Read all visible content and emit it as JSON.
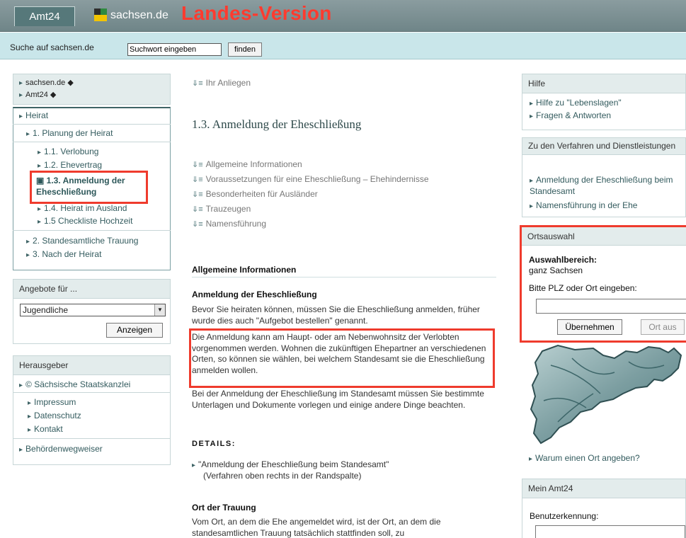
{
  "header": {
    "tab_label": "Amt24",
    "logo_text": "sachsen.de",
    "version_label": "Landes-Version"
  },
  "search": {
    "label": "Suche auf sachsen.de",
    "placeholder": "Suchwort eingeben",
    "button": "finden"
  },
  "left": {
    "breadcrumbs": [
      "sachsen.de",
      "Amt24"
    ],
    "nav": {
      "heirat": "Heirat",
      "planung": "1. Planung der Heirat",
      "verlobung": "1.1. Verlobung",
      "ehevertrag": "1.2. Ehevertrag",
      "active": "1.3. Anmeldung der Eheschließung",
      "ausland": "1.4. Heirat im Ausland",
      "checkliste": "1.5 Checkliste Hochzeit",
      "trauung": "2. Standesamtliche Trauung",
      "nach": "3. Nach der Heirat"
    },
    "angebote": {
      "title": "Angebote für ...",
      "selected": "Jugendliche",
      "button": "Anzeigen"
    },
    "herausgeber": {
      "title": "Herausgeber",
      "staatskanzlei": "© Sächsische Staatskanzlei",
      "impressum": "Impressum",
      "datenschutz": "Datenschutz",
      "kontakt": "Kontakt",
      "wegweiser": "Behördenwegweiser"
    }
  },
  "main": {
    "anliegen": "Ihr Anliegen",
    "title": "1.3. Anmeldung der Eheschließung",
    "toc": [
      "Allgemeine Informationen",
      "Voraussetzungen für eine Eheschließung – Ehehindernisse",
      "Besonderheiten für Ausländer",
      "Trauzeugen",
      "Namensführung"
    ],
    "section_allg": "Allgemeine Informationen",
    "sub_anmeldung": "Anmeldung der Eheschließung",
    "p1": "Bevor Sie heiraten können, müssen Sie die Eheschließung anmelden, früher wurde dies auch \"Aufgebot bestellen\" genannt.",
    "p2": "Die Anmeldung kann am Haupt- oder am Nebenwohnsitz der Verlobten vorgenommen werden. Wohnen die zukünftigen Ehepartner an verschiedenen Orten, so können sie wählen, bei welchem Standesamt sie die Eheschließung anmelden wollen.",
    "p3": "Bei der Anmeldung der Eheschließung im Standesamt müssen Sie bestimmte Unterlagen und Dokumente vorlegen und einige andere Dinge beachten.",
    "details": "DETAILS:",
    "detail_link": "\"Anmeldung der Eheschließung beim Standesamt\"",
    "detail_note": "(Verfahren oben rechts in der Randspalte)",
    "sub_ort": "Ort der Trauung",
    "p4": "Vom Ort, an dem die Ehe angemeldet wird, ist der Ort, an dem die standesamtlichen Trauung tatsächlich stattfinden soll, zu"
  },
  "right": {
    "hilfe": {
      "title": "Hilfe",
      "links": [
        "Hilfe zu \"Lebenslagen\"",
        "Fragen & Antworten"
      ]
    },
    "verfahren": {
      "title": "Zu den Verfahren und Dienstleistungen",
      "link1": "Anmeldung der Eheschließung beim Standesamt",
      "link2": "Namensführung in der Ehe"
    },
    "orts": {
      "title": "Ortsauswahl",
      "label": "Auswahlbereich:",
      "value": "ganz Sachsen",
      "prompt": "Bitte PLZ oder Ort eingeben:",
      "apply": "Übernehmen",
      "off": "Ort aus"
    },
    "warum": "Warum einen Ort angeben?",
    "mein": {
      "title": "Mein Amt24",
      "user_label": "Benutzerkennung:"
    }
  }
}
